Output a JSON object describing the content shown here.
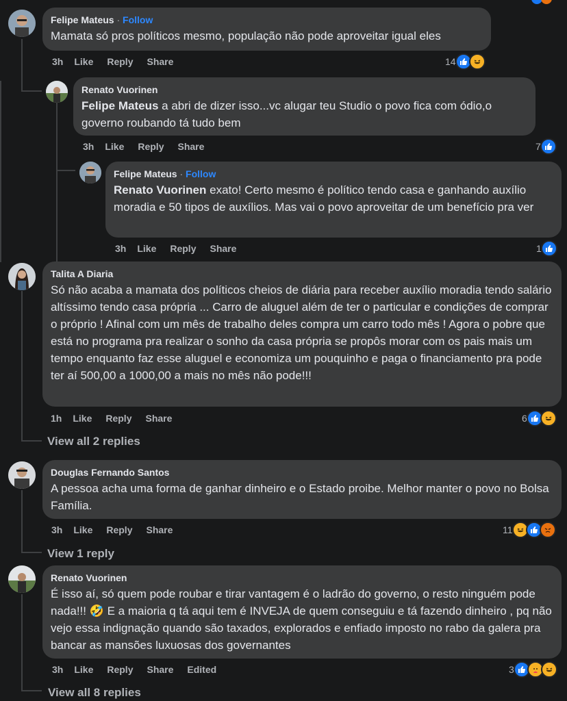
{
  "comments": [
    {
      "author": "Felipe Mateus",
      "follow": "Follow",
      "text": "Mamata só pros políticos mesmo, população não pode aproveitar igual eles",
      "time": "3h",
      "like": "Like",
      "reply": "Reply",
      "share": "Share",
      "reaction_count": "14",
      "reactions": [
        "like-icon",
        "haha-icon"
      ]
    },
    {
      "author": "Renato Vuorinen",
      "mention": "Felipe Mateus",
      "text": " a abri de dizer isso...vc alugar teu Studio o povo fica com ódio,o governo roubando tá tudo bem",
      "time": "3h",
      "like": "Like",
      "reply": "Reply",
      "share": "Share",
      "reaction_count": "7",
      "reactions": [
        "like-icon"
      ]
    },
    {
      "author": "Felipe Mateus",
      "follow": "Follow",
      "mention": "Renato Vuorinen",
      "text": " exato! Certo mesmo é político tendo casa e ganhando auxílio moradia e 50 tipos de auxílios. Mas vai o povo aproveitar de um benefício pra ver",
      "time": "3h",
      "like": "Like",
      "reply": "Reply",
      "share": "Share",
      "reaction_count": "1",
      "reactions": [
        "like-icon"
      ]
    },
    {
      "author": "Talita A Diaria",
      "text": "Só não acaba a mamata dos políticos cheios de diária para receber auxílio moradia tendo salário altíssimo tendo casa própria ... Carro de aluguel além de ter o particular e condições de comprar o próprio ! Afinal com um mês de trabalho deles compra um carro todo mês ! Agora o pobre que está no programa pra realizar o sonho da casa própria se propôs morar com os pais mais um tempo enquanto faz esse aluguel e economiza um pouquinho e paga o financiamento pra pode ter aí 500,00 a 1000,00 a mais no mês não pode!!!",
      "time": "1h",
      "like": "Like",
      "reply": "Reply",
      "share": "Share",
      "reaction_count": "6",
      "reactions": [
        "like-icon",
        "haha-icon"
      ],
      "view_replies": "View all 2 replies"
    },
    {
      "author": "Douglas Fernando Santos",
      "text": "A pessoa acha uma forma de ganhar dinheiro e o Estado proibe. Melhor manter o povo no Bolsa Família.",
      "time": "3h",
      "like": "Like",
      "reply": "Reply",
      "share": "Share",
      "reaction_count": "11",
      "reactions": [
        "haha-icon",
        "like-icon",
        "angry-icon"
      ],
      "view_replies": "View 1 reply"
    },
    {
      "author": "Renato Vuorinen",
      "text": "É isso aí, só quem pode roubar e tirar vantagem é o ladrão do governo, o resto ninguém pode nada!!! 🤣 E a maioria q tá aqui tem é INVEJA de quem conseguiu e tá fazendo dinheiro , pq não vejo essa indignação quando são taxados, explorados e enfiado imposto no rabo da galera pra bancar as mansões luxuosas dos governantes",
      "time": "3h",
      "like": "Like",
      "reply": "Reply",
      "share": "Share",
      "edited": "Edited",
      "reaction_count": "3",
      "reactions": [
        "like-icon",
        "care-icon",
        "haha-icon"
      ],
      "view_replies": "View all 8 replies"
    }
  ],
  "colors": {
    "background": "#18191a",
    "bubble": "#3a3b3c",
    "text": "#e4e6eb",
    "secondary": "#b0b3b8",
    "link": "#2d88ff",
    "like": "#1877f2",
    "haha": "#f7b125"
  }
}
